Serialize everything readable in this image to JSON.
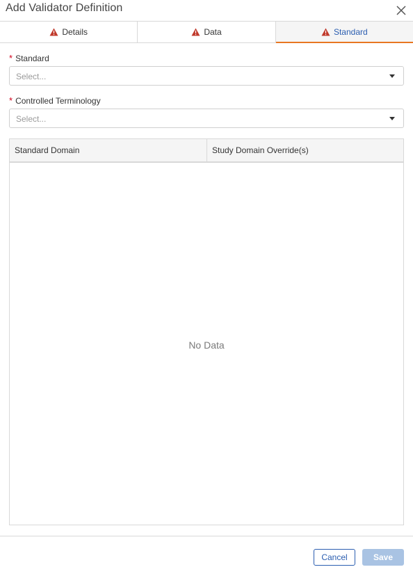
{
  "dialog": {
    "title": "Add Validator Definition"
  },
  "tabs": [
    {
      "label": "Details",
      "icon": "warning-icon",
      "active": false
    },
    {
      "label": "Data",
      "icon": "warning-icon",
      "active": false
    },
    {
      "label": "Standard",
      "icon": "warning-icon",
      "active": true
    }
  ],
  "form": {
    "standard": {
      "required_marker": "*",
      "label": "Standard",
      "placeholder": "Select..."
    },
    "controlled_terminology": {
      "required_marker": "*",
      "label": "Controlled Terminology",
      "placeholder": "Select..."
    }
  },
  "grid": {
    "columns": [
      "Standard Domain",
      "Study Domain Override(s)"
    ],
    "empty_text": "No Data"
  },
  "footer": {
    "cancel_label": "Cancel",
    "save_label": "Save"
  },
  "colors": {
    "accent_blue": "#2a5db0",
    "active_tab_underline": "#e87722",
    "warning_red": "#c0392b",
    "required_red": "#d0021b",
    "save_disabled": "#a9c3e3"
  }
}
